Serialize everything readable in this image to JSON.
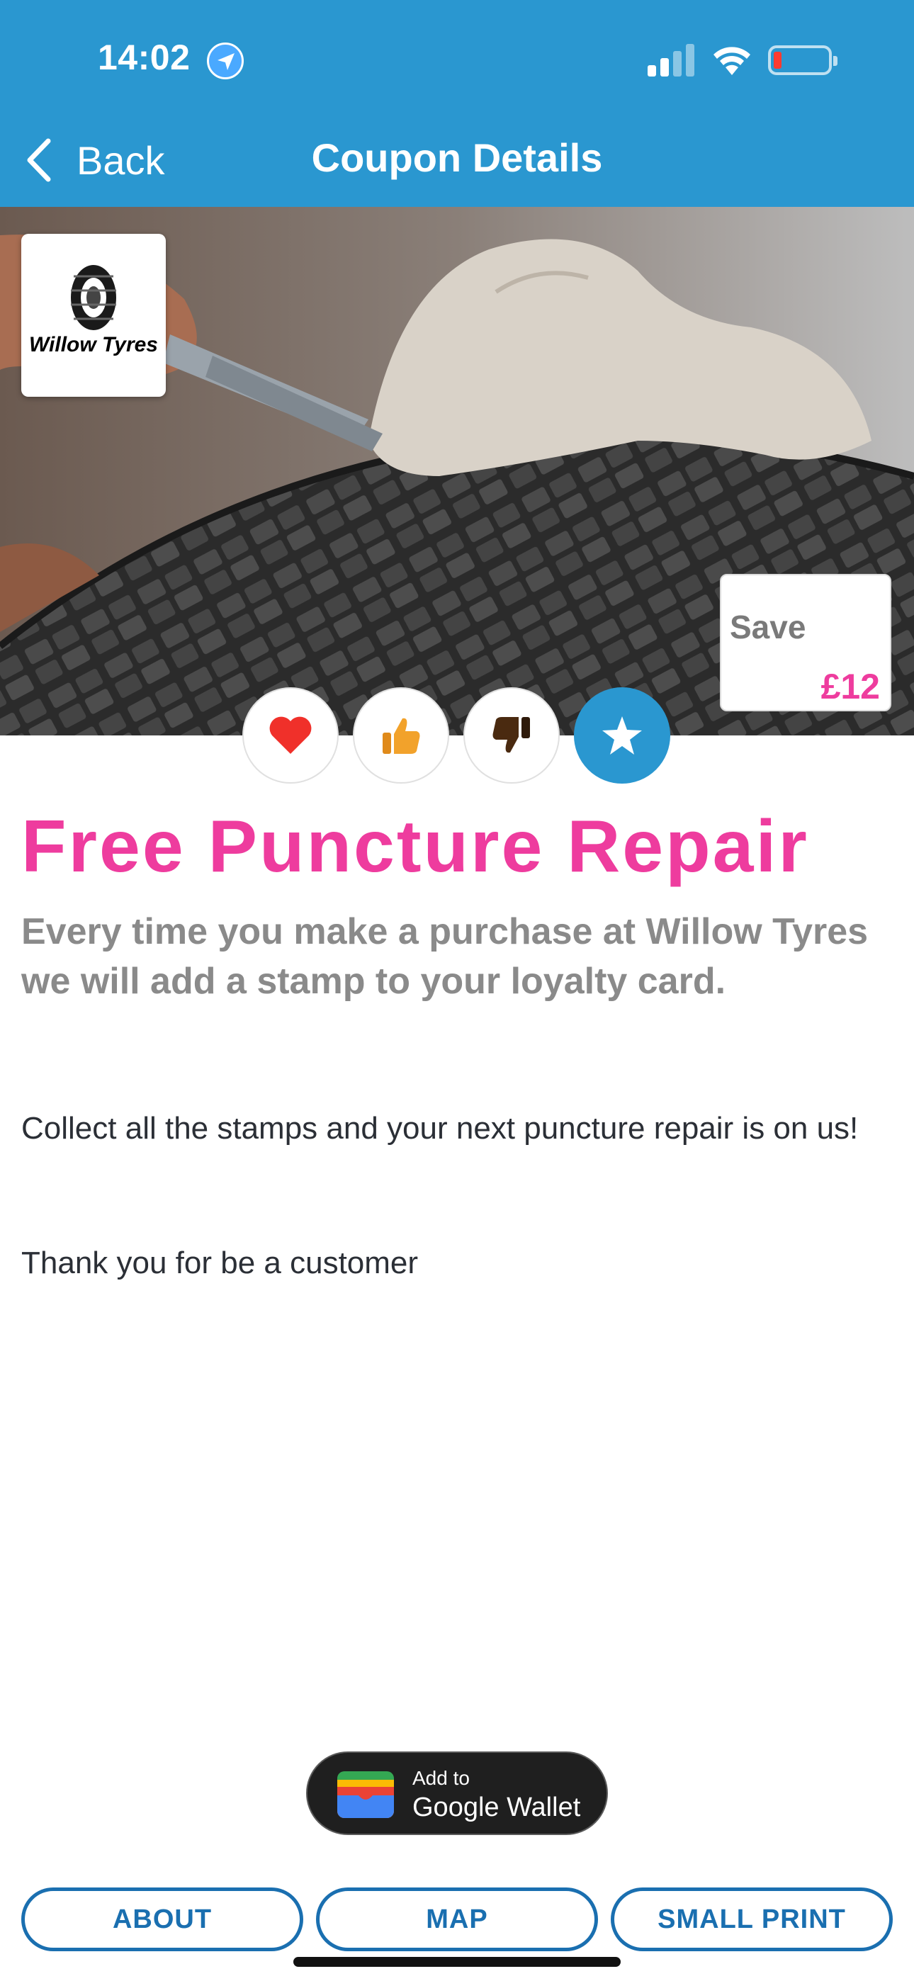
{
  "status_bar": {
    "time": "14:02"
  },
  "nav": {
    "back_label": "Back",
    "title": "Coupon Details"
  },
  "hero": {
    "brand_logo_text": "Willow Tyres",
    "save_label": "Save",
    "save_value": "£12"
  },
  "reactions": [
    {
      "name": "heart",
      "color": "#f0302a"
    },
    {
      "name": "thumbs-up",
      "color": "#f2a22b"
    },
    {
      "name": "thumbs-down",
      "color": "#4a2a10"
    },
    {
      "name": "favorite-star",
      "color": "#2a97d0"
    }
  ],
  "coupon": {
    "title": "Free Puncture Repair",
    "subtitle": "Every time you make a purchase at Willow Tyres we will add a stamp to your loyalty card.",
    "paragraph_1": "Collect all the stamps and your next puncture repair is on us!",
    "paragraph_2": "Thank you for be a customer"
  },
  "wallet": {
    "line_1": "Add to",
    "line_2": "Google Wallet"
  },
  "tabs": {
    "about": "ABOUT",
    "map": "MAP",
    "small_print": "SMALL PRINT"
  },
  "colors": {
    "header_bg": "#2a97d0",
    "title_pink": "#ee3c9e",
    "tab_blue": "#1a6fb0"
  }
}
